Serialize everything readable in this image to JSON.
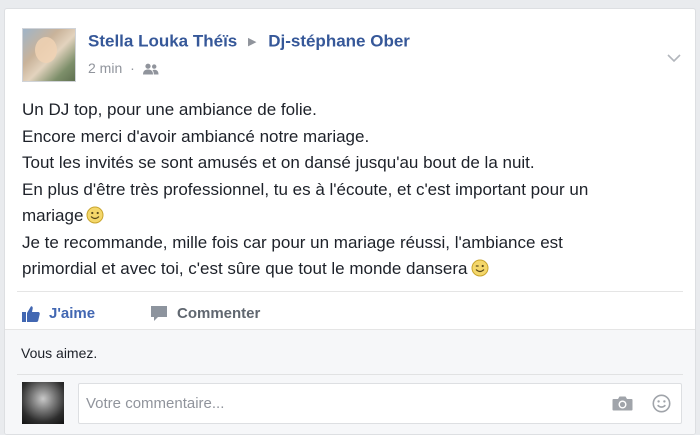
{
  "post": {
    "author": "Stella Louka Théïs",
    "target": "Dj-stéphane Ober",
    "time": "2 min",
    "separator": "·",
    "body": [
      "Un DJ top, pour une ambiance de folie.",
      "Encore merci d'avoir ambiancé notre mariage.",
      "Tout les invités se sont amusés et on dansé jusqu'au bout de la nuit.",
      "En plus d'être très professionnel, tu es à l'écoute, et c'est important pour un",
      "mariage",
      "Je te recommande, mille fois car pour un mariage réussi, l'ambiance est",
      "primordial et avec toi, c'est sûre que tout le monde dansera"
    ]
  },
  "actions": {
    "like_label": "J'aime",
    "comment_label": "Commenter"
  },
  "feedback": {
    "likes_text": "Vous aimez.",
    "comment_placeholder": "Votre commentaire..."
  },
  "colors": {
    "link": "#365899",
    "like_active": "#4267b2",
    "muted": "#90949c"
  },
  "icons": {
    "audience": "friends-icon",
    "options": "chevron-down-icon",
    "like": "thumbs-up-icon",
    "comment": "comment-bubble-icon",
    "camera": "camera-icon",
    "emoji": "emoji-icon"
  }
}
